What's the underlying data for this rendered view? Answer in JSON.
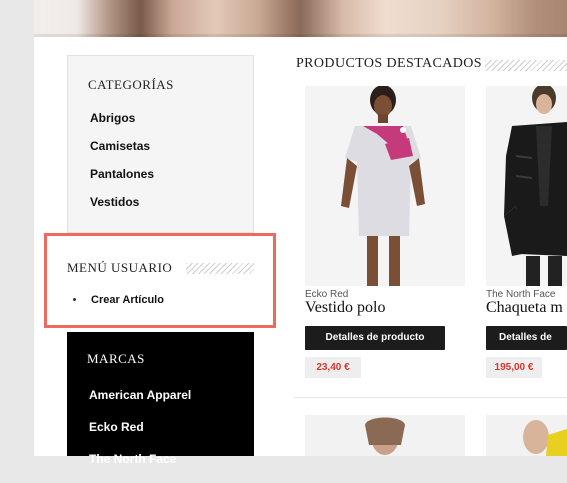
{
  "sidebar": {
    "categories": {
      "title": "Categorías",
      "items": [
        "Abrigos",
        "Camisetas",
        "Pantalones",
        "Vestidos"
      ]
    },
    "user_menu": {
      "title": "Menú Usuario",
      "items": [
        "Crear Artículo"
      ]
    },
    "brands": {
      "title": "Marcas",
      "items": [
        "American Apparel",
        "Ecko Red",
        "The North Face"
      ]
    }
  },
  "main": {
    "title": "Productos destacados",
    "products": [
      {
        "brand": "Ecko Red",
        "name": "Vestido polo",
        "button": "Detalles de producto",
        "price": "23,40 €"
      },
      {
        "brand": "The North Face",
        "name": "Chaqueta m",
        "button": "Detalles de producto",
        "price": "195,00 €"
      }
    ]
  },
  "colors": {
    "highlight": "#ec6b5e",
    "price": "#d9352c",
    "button": "#1c1c1c"
  }
}
